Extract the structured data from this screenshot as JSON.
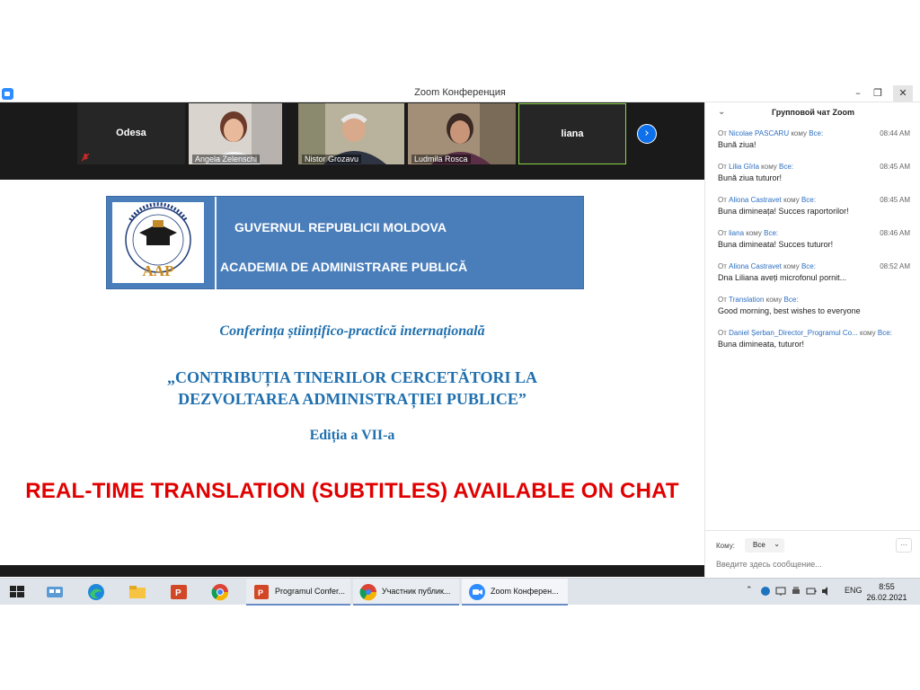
{
  "window": {
    "title": "Zoom Конференция"
  },
  "gallery": {
    "tiles": [
      {
        "name": "Odesa",
        "video": false
      },
      {
        "name": "Angela Zelenschi",
        "video": true
      },
      {
        "name": "Nistor Grozavu",
        "video": true
      },
      {
        "name": "Ludmila Rosca",
        "video": true
      },
      {
        "name": "liana",
        "video": false
      }
    ]
  },
  "slide": {
    "logo_text": "AAP",
    "gov_line": "GUVERNUL REPUBLICII MOLDOVA",
    "academy_line": "ACADEMIA DE ADMINISTRARE PUBLICĂ",
    "conference_line": "Conferința științifico-practică internațională",
    "title_line1": "„CONTRIBUȚIA TINERILOR CERCETĂTORI LA",
    "title_line2": "DEZVOLTAREA ADMINISTRAȚIEI PUBLICE”",
    "edition": "Ediția a VII-a",
    "banner": "REAL-TIME TRANSLATION (SUBTITLES) AVAILABLE ON CHAT"
  },
  "chat": {
    "title": "Групповой чат Zoom",
    "from_prefix": "От",
    "to_word": "кому",
    "messages": [
      {
        "from": "Nicolae PASCARU",
        "to": "Все:",
        "time": "08:44 AM",
        "text": "Bună ziua!"
      },
      {
        "from": "Lilia Gîrla",
        "to": "Все:",
        "time": "08:45 AM",
        "text": "Bună ziua tuturor!"
      },
      {
        "from": "Aliona Castravet",
        "to": "Все:",
        "time": "08:45 AM",
        "text": "Buna dimineața! Succes raportorilor!"
      },
      {
        "from": "liana",
        "to": "Все:",
        "time": "08:46 AM",
        "text": "Buna dimineata! Succes tuturor!"
      },
      {
        "from": "Aliona Castravet",
        "to": "Все:",
        "time": "08:52 AM",
        "text": "Dna Liliana aveți microfonul pornit..."
      },
      {
        "from": "Translation",
        "to": "Все:",
        "time": "",
        "text": "Good morning, best wishes to everyone"
      },
      {
        "from": "Daniel Șerban_Director_Programul Co...",
        "to": "Все:",
        "time": "",
        "text": "Buna dimineata, tuturor!"
      }
    ],
    "to_label": "Кому:",
    "to_value": "Все",
    "more": "···",
    "input_placeholder": "Введите здесь сообщение..."
  },
  "taskbar": {
    "buttons": [
      {
        "label": "Programul Confer...",
        "color": "#d24726"
      },
      {
        "label": "Участник публик...",
        "color": "#4285f4"
      },
      {
        "label": "Zoom Конферен...",
        "color": "#2d8cff"
      }
    ],
    "lang": "ENG",
    "time": "8:55",
    "date": "26.02.2021"
  },
  "colors": {
    "header_blue": "#4a7ebb",
    "title_blue": "#1f6fae",
    "banner_red": "#e10000",
    "zoom_blue": "#2d8cff"
  }
}
